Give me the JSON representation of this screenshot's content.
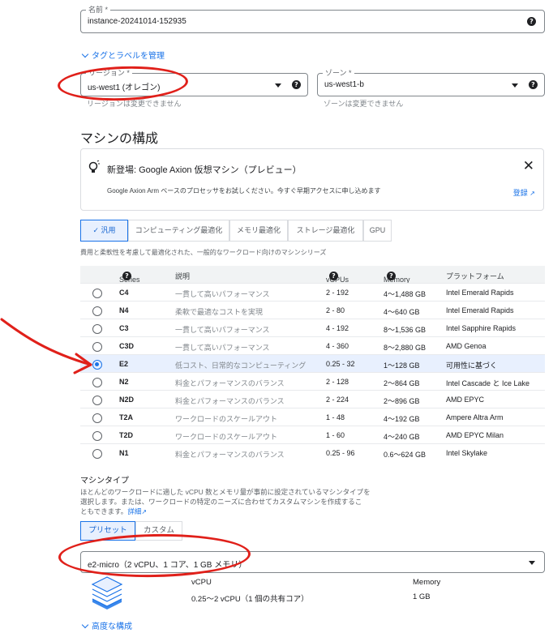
{
  "name_field": {
    "label": "名前 *",
    "value": "instance-20241014-152935"
  },
  "tags_link": "タグとラベルを管理",
  "region": {
    "label": "リージョン *",
    "value": "us-west1 (オレゴン)",
    "hint": "リージョンは変更できません"
  },
  "zone": {
    "label": "ゾーン *",
    "value": "us-west1-b",
    "hint": "ゾーンは変更できません"
  },
  "machine_config_title": "マシンの構成",
  "preview_card": {
    "title": "新登場: Google Axion 仮想マシン（プレビュー）",
    "body": "Google Axion Arm ベースのプロセッサをお試しください。今すぐ早期アクセスに申し込めます",
    "register_link": "登録"
  },
  "family_tabs": [
    "汎用",
    "コンピューティング最適化",
    "メモリ最適化",
    "ストレージ最適化",
    "GPU"
  ],
  "family_desc": "費用と柔軟性を考慮して最適化された、一般的なワークロード向けのマシンシリーズ",
  "table": {
    "headers": {
      "series": "Series",
      "desc": "説明",
      "vcpus": "vCPUs",
      "memory": "Memory",
      "platform": "プラットフォーム"
    },
    "rows": [
      {
        "series": "C4",
        "desc": "一貫して高いパフォーマンス",
        "vcpus": "2 - 192",
        "memory": "4～1,488 GB",
        "platform": "Intel Emerald Rapids"
      },
      {
        "series": "N4",
        "desc": "柔軟で最適なコストを実現",
        "vcpus": "2 - 80",
        "memory": "4～640 GB",
        "platform": "Intel Emerald Rapids"
      },
      {
        "series": "C3",
        "desc": "一貫して高いパフォーマンス",
        "vcpus": "4 - 192",
        "memory": "8～1,536 GB",
        "platform": "Intel Sapphire Rapids"
      },
      {
        "series": "C3D",
        "desc": "一貫して高いパフォーマンス",
        "vcpus": "4 - 360",
        "memory": "8～2,880 GB",
        "platform": "AMD Genoa"
      },
      {
        "series": "E2",
        "desc": "低コスト、日常的なコンピューティング",
        "vcpus": "0.25 - 32",
        "memory": "1～128 GB",
        "platform": "可用性に基づく"
      },
      {
        "series": "N2",
        "desc": "料金とパフォーマンスのバランス",
        "vcpus": "2 - 128",
        "memory": "2～864 GB",
        "platform": "Intel Cascade と Ice Lake"
      },
      {
        "series": "N2D",
        "desc": "料金とパフォーマンスのバランス",
        "vcpus": "2 - 224",
        "memory": "2～896 GB",
        "platform": "AMD EPYC"
      },
      {
        "series": "T2A",
        "desc": "ワークロードのスケールアウト",
        "vcpus": "1 - 48",
        "memory": "4～192 GB",
        "platform": "Ampere Altra Arm"
      },
      {
        "series": "T2D",
        "desc": "ワークロードのスケールアウト",
        "vcpus": "1 - 60",
        "memory": "4～240 GB",
        "platform": "AMD EPYC Milan"
      },
      {
        "series": "N1",
        "desc": "料金とパフォーマンスのバランス",
        "vcpus": "0.25 - 96",
        "memory": "0.6～624 GB",
        "platform": "Intel Skylake"
      }
    ],
    "selected_series": "E2"
  },
  "machine_type": {
    "title": "マシンタイプ",
    "desc_line1": "ほとんどのワークロードに適した vCPU 数とメモリ量が事前に設定されているマシンタイプを",
    "desc_line2": "選択します。または、ワークロードの特定のニーズに合わせてカスタムマシンを作成するこ",
    "desc_line3_prefix": "ともできます。",
    "details_link": "詳細",
    "tabs": [
      "プリセット",
      "カスタム"
    ],
    "selected": "e2-micro（2 vCPU、1 コア、1 GB メモリ）",
    "vcpu_label": "vCPU",
    "vcpu_value": "0.25～2 vCPU（1 個の共有コア）",
    "memory_label": "Memory",
    "memory_value": "1 GB"
  },
  "advanced_link": "高度な構成",
  "colors": {
    "accent": "#1a73e8",
    "annotation": "#e0201a"
  }
}
